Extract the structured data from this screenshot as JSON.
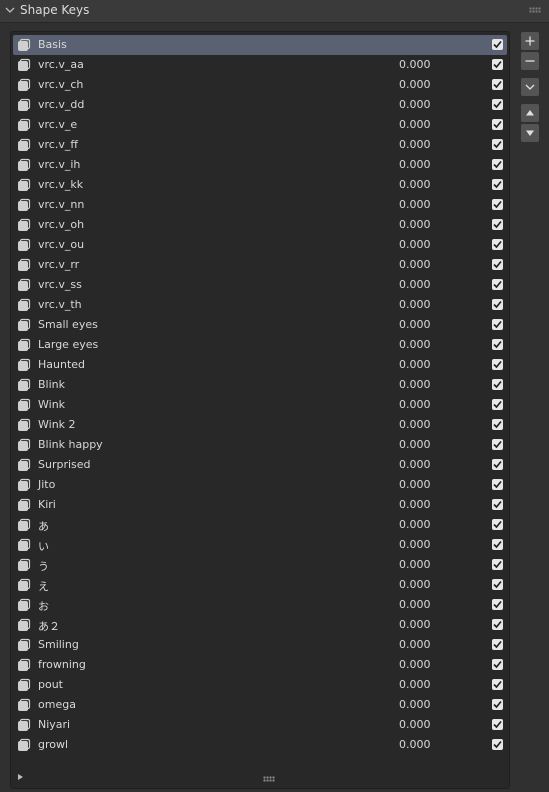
{
  "panel": {
    "title": "Shape Keys"
  },
  "shape_keys": [
    {
      "name": "Basis",
      "value": "",
      "active": true
    },
    {
      "name": "vrc.v_aa",
      "value": "0.000"
    },
    {
      "name": "vrc.v_ch",
      "value": "0.000"
    },
    {
      "name": "vrc.v_dd",
      "value": "0.000"
    },
    {
      "name": "vrc.v_e",
      "value": "0.000"
    },
    {
      "name": "vrc.v_ff",
      "value": "0.000"
    },
    {
      "name": "vrc.v_ih",
      "value": "0.000"
    },
    {
      "name": "vrc.v_kk",
      "value": "0.000"
    },
    {
      "name": "vrc.v_nn",
      "value": "0.000"
    },
    {
      "name": "vrc.v_oh",
      "value": "0.000"
    },
    {
      "name": "vrc.v_ou",
      "value": "0.000"
    },
    {
      "name": "vrc.v_rr",
      "value": "0.000"
    },
    {
      "name": "vrc.v_ss",
      "value": "0.000"
    },
    {
      "name": "vrc.v_th",
      "value": "0.000"
    },
    {
      "name": "Small eyes",
      "value": "0.000"
    },
    {
      "name": "Large eyes",
      "value": "0.000"
    },
    {
      "name": "Haunted",
      "value": "0.000"
    },
    {
      "name": "Blink",
      "value": "0.000"
    },
    {
      "name": "Wink",
      "value": "0.000"
    },
    {
      "name": "Wink 2",
      "value": "0.000"
    },
    {
      "name": "Blink happy",
      "value": "0.000"
    },
    {
      "name": "Surprised",
      "value": "0.000"
    },
    {
      "name": "Jito",
      "value": "0.000"
    },
    {
      "name": "Kiri",
      "value": "0.000"
    },
    {
      "name": "あ",
      "value": "0.000"
    },
    {
      "name": "い",
      "value": "0.000"
    },
    {
      "name": "う",
      "value": "0.000"
    },
    {
      "name": "え",
      "value": "0.000"
    },
    {
      "name": "お",
      "value": "0.000"
    },
    {
      "name": "あ２",
      "value": "0.000"
    },
    {
      "name": "Smiling",
      "value": "0.000"
    },
    {
      "name": "frowning",
      "value": "0.000"
    },
    {
      "name": "pout",
      "value": "0.000"
    },
    {
      "name": "omega",
      "value": "0.000"
    },
    {
      "name": "Niyari",
      "value": "0.000"
    },
    {
      "name": "growl",
      "value": "0.000"
    }
  ],
  "side_buttons": [
    {
      "name": "add-shape-key-button",
      "icon": "plus-icon"
    },
    {
      "name": "remove-shape-key-button",
      "icon": "minus-icon"
    },
    {
      "name": "specials-menu-button",
      "icon": "chevron-down-icon"
    },
    {
      "name": "move-up-button",
      "icon": "triangle-up-icon"
    },
    {
      "name": "move-down-button",
      "icon": "triangle-down-icon"
    }
  ],
  "colors": {
    "panel_bg": "#303030",
    "list_bg": "#282828",
    "active_row": "#5a6172",
    "checkbox": "#e8e8e8"
  }
}
